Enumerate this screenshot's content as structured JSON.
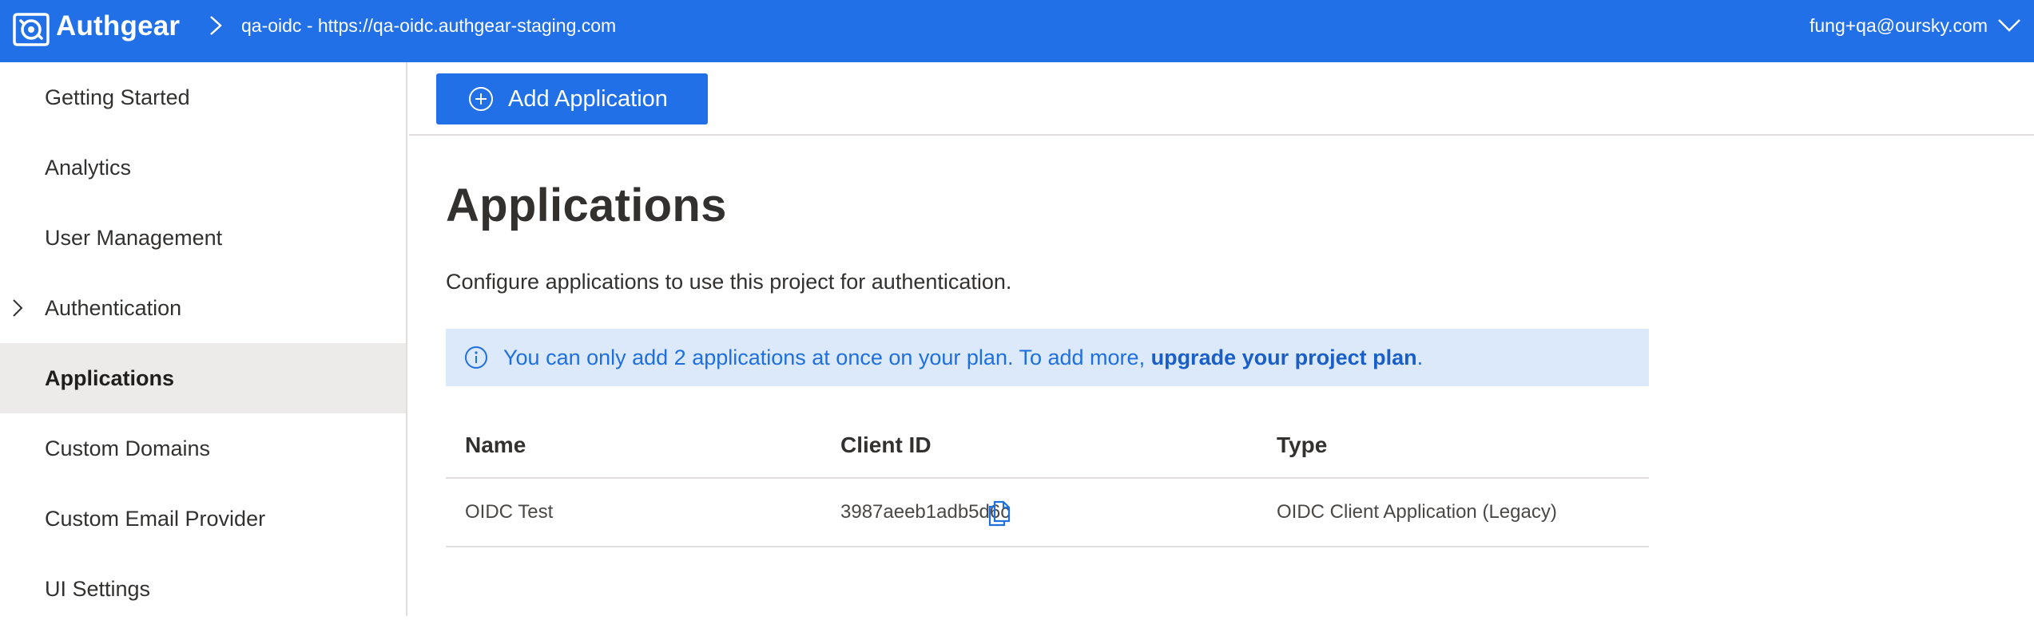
{
  "header": {
    "brand": "Authgear",
    "project": "qa-oidc - https://qa-oidc.authgear-staging.com",
    "user_email": "fung+qa@oursky.com"
  },
  "sidebar": {
    "items": [
      {
        "label": "Getting Started"
      },
      {
        "label": "Analytics"
      },
      {
        "label": "User Management"
      },
      {
        "label": "Authentication",
        "expandable": true
      },
      {
        "label": "Applications",
        "active": true
      },
      {
        "label": "Custom Domains"
      },
      {
        "label": "Custom Email Provider"
      },
      {
        "label": "UI Settings"
      }
    ]
  },
  "command_bar": {
    "add_label": "Add Application"
  },
  "main": {
    "title": "Applications",
    "description": "Configure applications to use this project for authentication.",
    "info": {
      "text": "You can only add 2 applications at once on your plan. To add more, ",
      "link": "upgrade your project plan",
      "suffix": "."
    },
    "table": {
      "columns": [
        "Name",
        "Client ID",
        "Type"
      ],
      "rows": [
        {
          "name": "OIDC Test",
          "client_id": "3987aeeb1adb5d6c",
          "type": "OIDC Client Application (Legacy)"
        }
      ]
    }
  },
  "colors": {
    "accent": "#2270e8",
    "info_bg": "#dce9fb",
    "active_nav": "#edebe9"
  },
  "icons": [
    "authgear-logo-icon",
    "chevron-right-icon",
    "chevron-down-icon",
    "plus-circle-icon",
    "info-icon",
    "copy-icon"
  ]
}
